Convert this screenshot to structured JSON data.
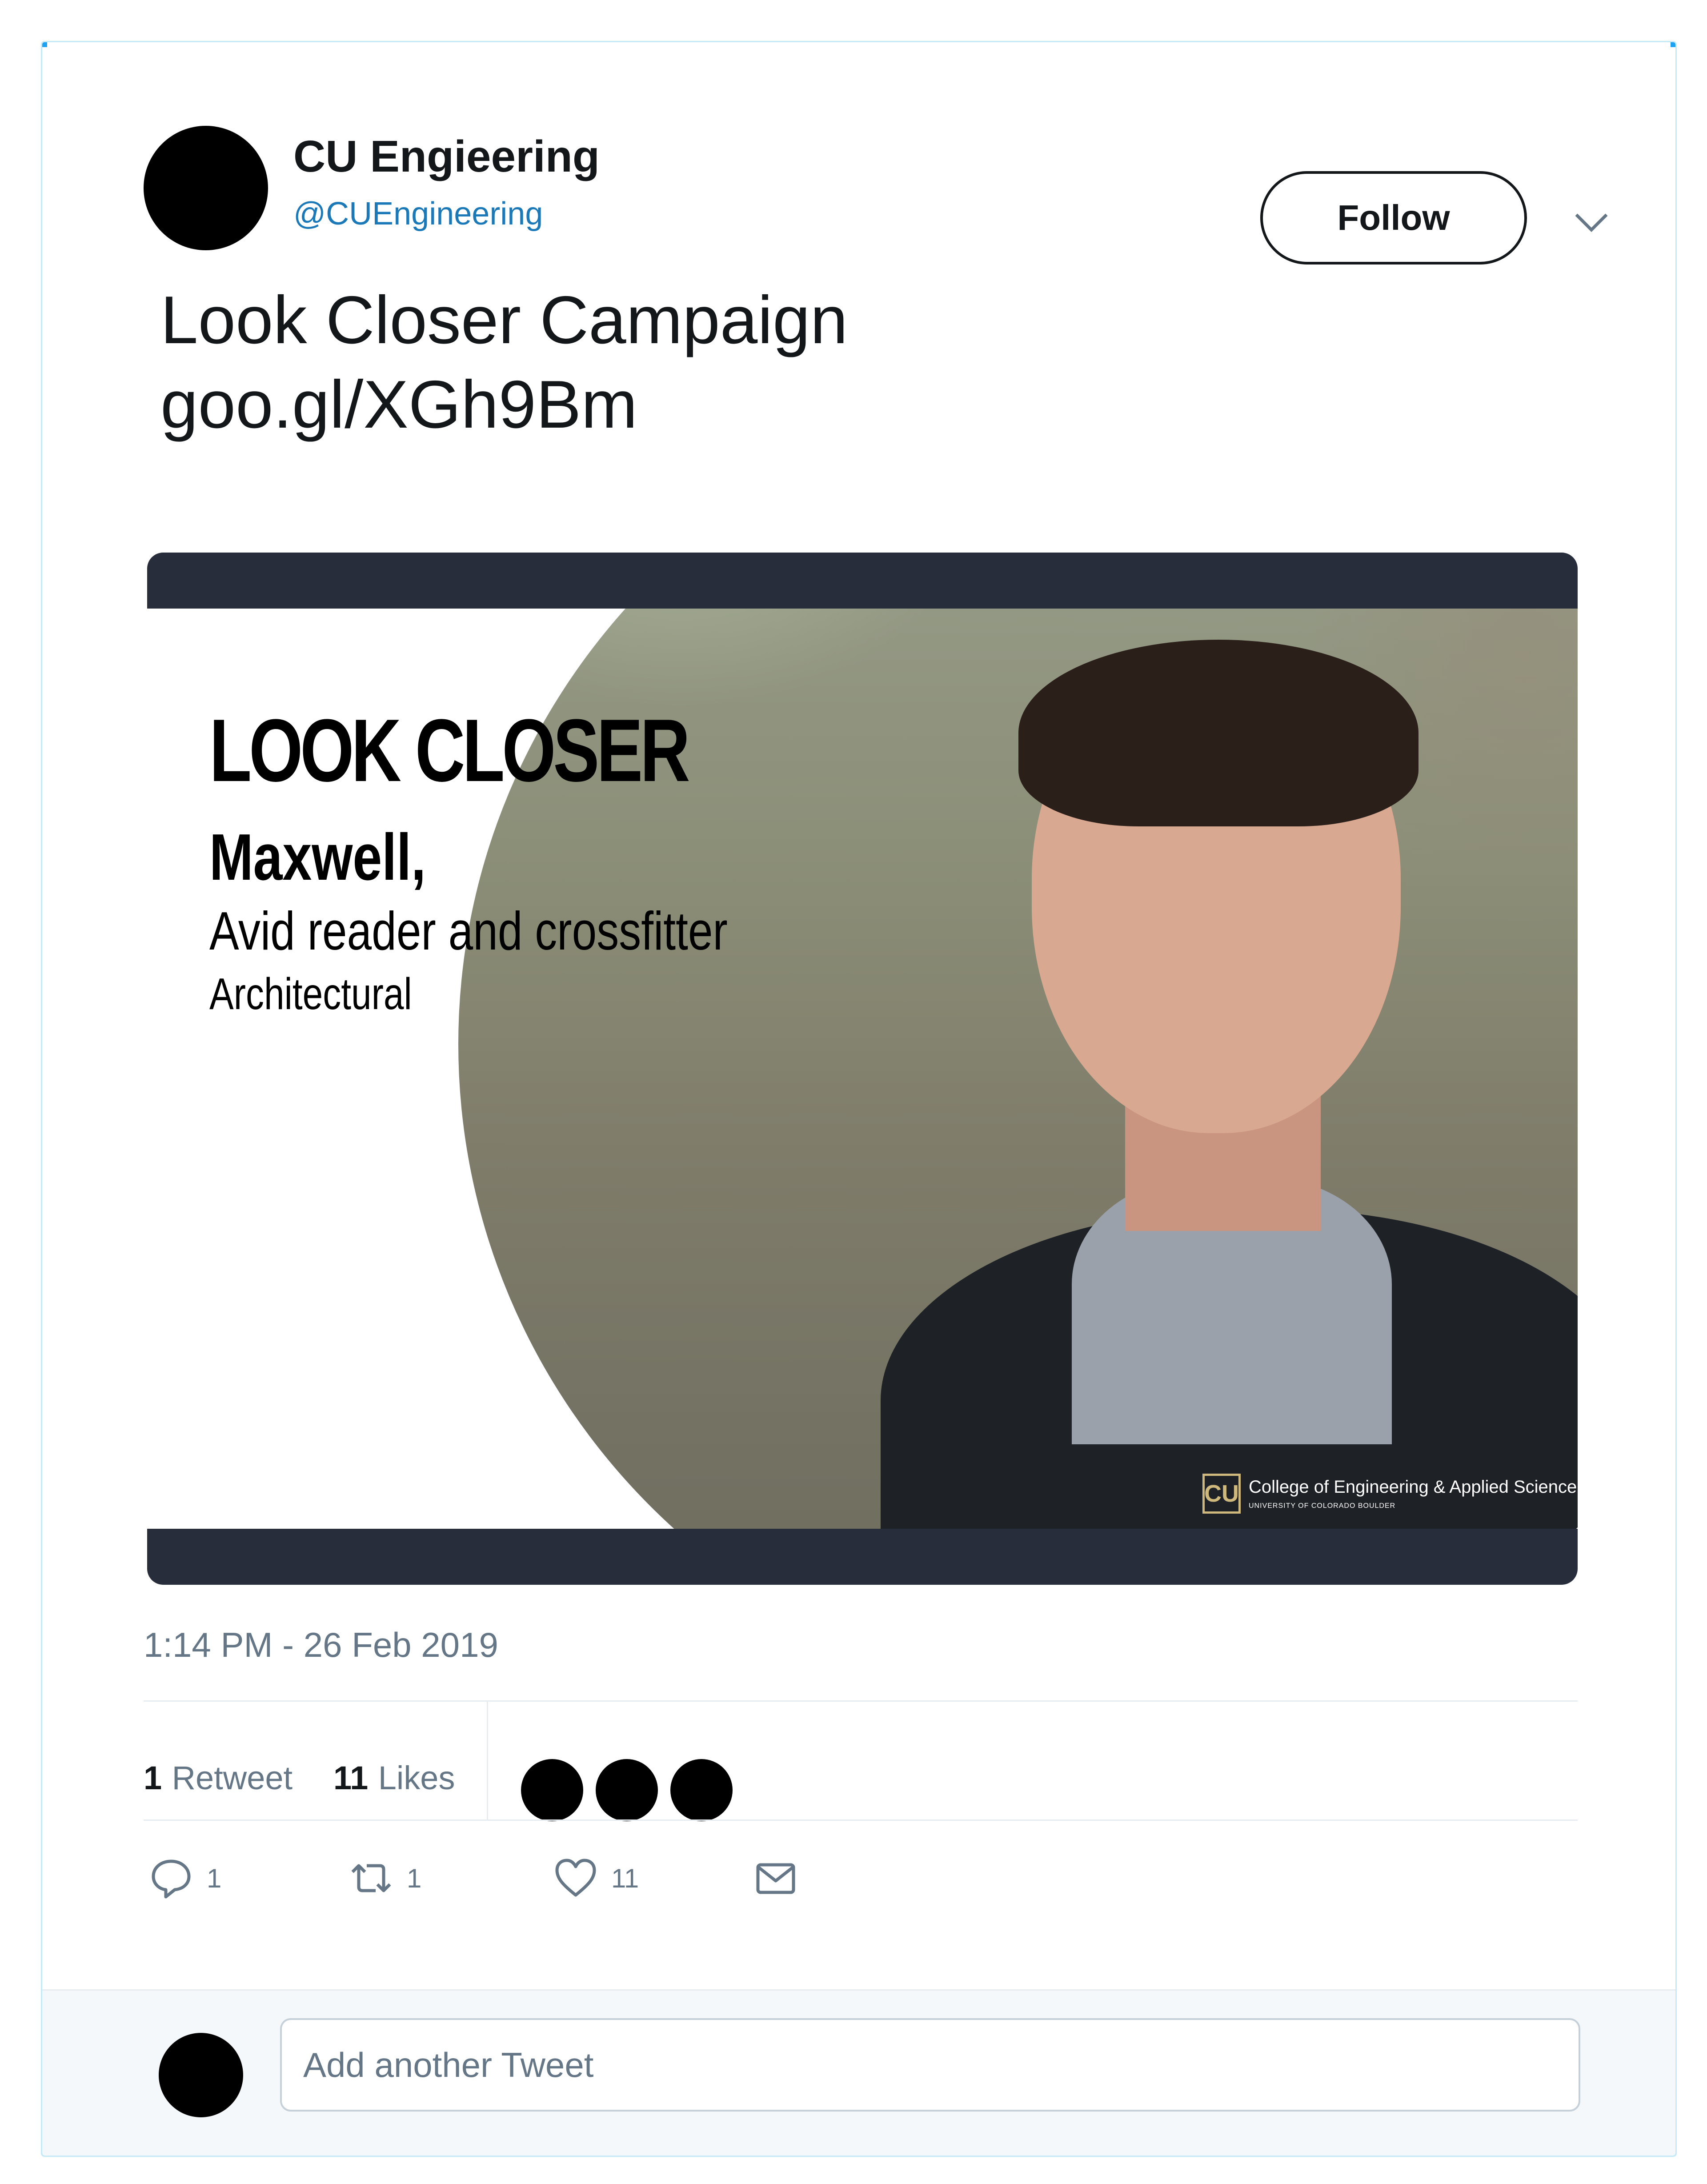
{
  "account": {
    "name": "CU Engieering",
    "handle": "@CUEngineering",
    "follow_label": "Follow"
  },
  "tweet": {
    "line1": "Look Closer Campaign",
    "line2": "goo.gl/XGh9Bm"
  },
  "media": {
    "headline": "LOOK CLOSER",
    "name": "Maxwell,",
    "description": "Avid reader and crossfitter",
    "major": "Architectural",
    "logo_mark": "CU",
    "org_name": "College of Engineering & Applied Science",
    "org_sub": "UNIVERSITY OF COLORADO BOULDER"
  },
  "timestamp": "1:14 PM - 26 Feb 2019",
  "stats": {
    "retweet_count": "1",
    "retweet_label": "Retweet",
    "like_count": "11",
    "like_label": "Likes"
  },
  "actions": {
    "reply_count": "1",
    "retweet_count": "1",
    "like_count": "11",
    "icons": [
      "reply-icon",
      "retweet-icon",
      "heart-icon",
      "envelope-icon"
    ]
  },
  "reply": {
    "placeholder": "Add another Tweet"
  },
  "colors": {
    "handle": "#1b79b8",
    "muted": "#657786",
    "media_bar": "#272d3b",
    "accent_border": "#c6e9f7"
  }
}
